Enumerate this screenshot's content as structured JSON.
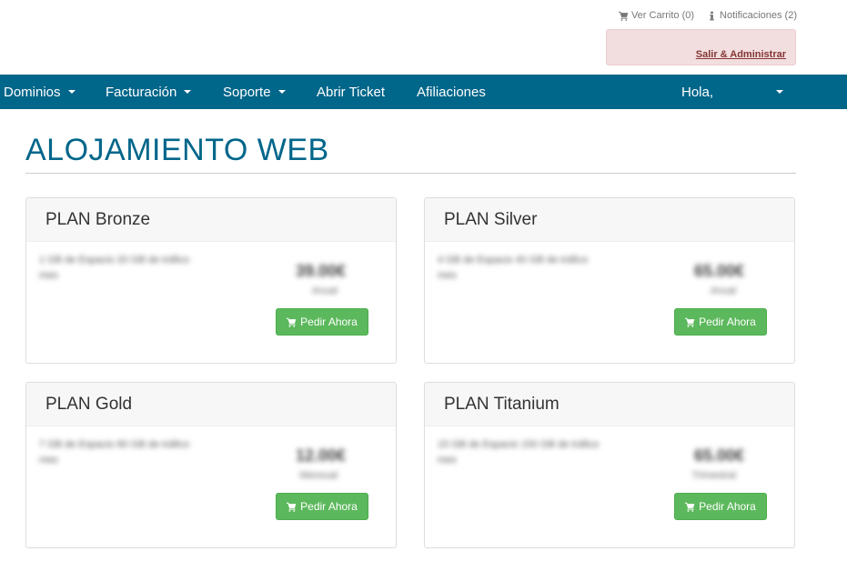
{
  "header": {
    "cart_label": "Ver Carrito (0)",
    "notifications_label": "Notificaciones (2)",
    "admin_link": "Salir & Administrar"
  },
  "nav": {
    "items": [
      {
        "label": "Dominios"
      },
      {
        "label": "Facturación"
      },
      {
        "label": "Soporte"
      },
      {
        "label": "Abrir Ticket"
      },
      {
        "label": "Afiliaciones"
      }
    ],
    "greeting": "Hola,"
  },
  "page": {
    "title": "ALOJAMIENTO WEB"
  },
  "plans": [
    {
      "name": "PLAN Bronze",
      "desc": "1 GB de Espacio 20 GB de tráfico mes",
      "price": "39.00€",
      "cycle": "Anual",
      "button": "Pedir Ahora"
    },
    {
      "name": "PLAN Silver",
      "desc": "4 GB de Espacio 40 GB de tráfico mes",
      "price": "65.00€",
      "cycle": "Anual",
      "button": "Pedir Ahora"
    },
    {
      "name": "PLAN Gold",
      "desc": "7 GB de Espacio 80 GB de tráfico mes",
      "price": "12.00€",
      "cycle": "Mensual",
      "button": "Pedir Ahora"
    },
    {
      "name": "PLAN Titanium",
      "desc": "15 GB de Espacio 150 GB de tráfico mes",
      "price": "65.00€",
      "cycle": "Trimestral",
      "button": "Pedir Ahora"
    }
  ],
  "colors": {
    "brand": "#00668a",
    "order_button": "#5cb85c",
    "admin_box": "#f2dede"
  }
}
